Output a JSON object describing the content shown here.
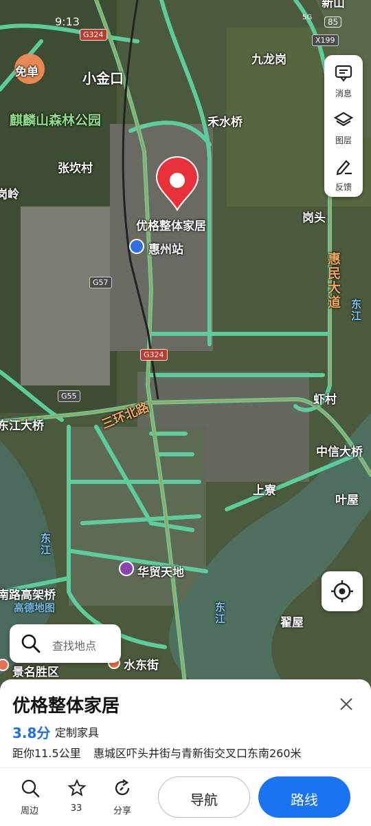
{
  "status": {
    "time": "9:13",
    "battery": "85",
    "net": "5G"
  },
  "map": {
    "places": {
      "xiaojinkou": "小金口",
      "qilinshan": "麒麟山森林公园",
      "hesuiqiao": "禾水桥",
      "jiulonggang": "九龙岗",
      "zhangkancun": "张坎村",
      "gangtou": "岗头",
      "huizhouzhan": "惠州站",
      "huimindadao": "惠民大道",
      "dongjiang1": "东江",
      "xiacun": "虾村",
      "dongjiangdaqiao": "东江大桥",
      "sanhuanbeilu": "三环北路",
      "zhongxindaqiao": "中信大桥",
      "shangliao": "上寮",
      "yewu": "叶屋",
      "dongjiang2": "东江",
      "huamaotiandi": "华贸天地",
      "viaduct": "南路高架桥",
      "dongjiang3": "东江",
      "diwu": "翟屋",
      "jingmingshengqu": "景名胜区",
      "shuidongjie": "水东街",
      "xinshan": "新山",
      "gangling": "岗岭",
      "watermark": "高德地图"
    },
    "shields": {
      "g324a": "G324",
      "g324b": "G324",
      "g57": "G57",
      "g55": "G55",
      "x199": "X199"
    },
    "marker_label": "优格整体家居",
    "free_badge": "免单"
  },
  "tools": {
    "messages": "消息",
    "layers": "图层",
    "feedback": "反馈"
  },
  "search": {
    "placeholder": "查找地点"
  },
  "poi": {
    "title": "优格整体家居",
    "rating": "3.8分",
    "category": "定制家具",
    "distance": "距你11.5公里",
    "address": "惠城区吓头井街与青新街交叉口东南260米"
  },
  "actions": {
    "nearby": "周边",
    "favorite_count": "33",
    "share": "分享",
    "navigate": "导航",
    "route": "路线"
  },
  "colors": {
    "accent": "#1a73f0",
    "marker": "#e8313a",
    "road": "#5ed2a0"
  }
}
